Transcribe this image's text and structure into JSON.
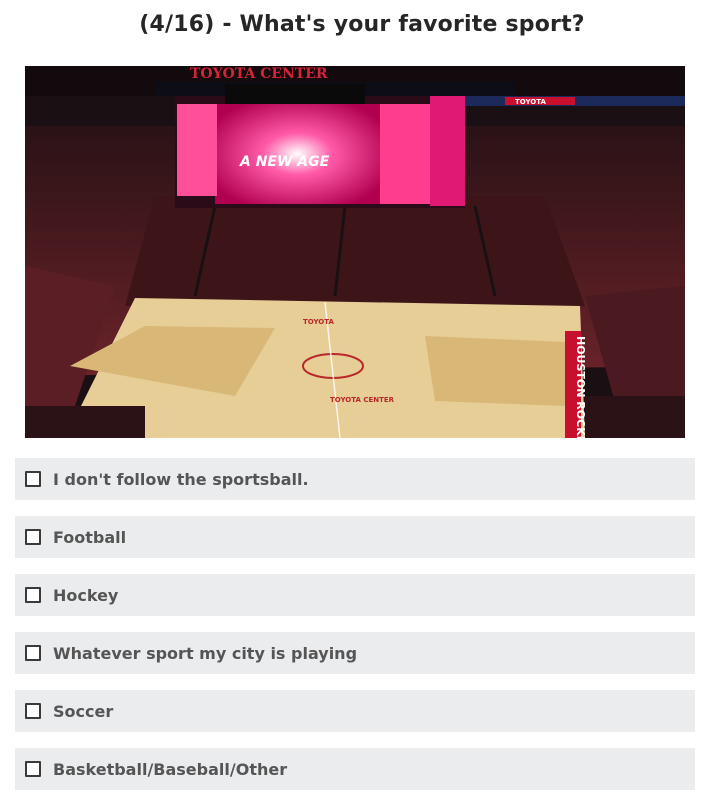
{
  "question": {
    "title": "(4/16) - What's your favorite sport?"
  },
  "photo": {
    "arena_sign": "TOYOTA CENTER",
    "scoreboard_text": "A NEW AGE",
    "court_text_top": "TOYOTA",
    "court_text_bottom": "TOYOTA CENTER",
    "baseline_text": "HOUSTON ROCKETS",
    "banner_right": "TOYOTA",
    "colors": {
      "court": "#e7cd96",
      "paint": "#d9b877",
      "seats": "#5a1e24",
      "screen": "#ff2f8a",
      "dark": "#1a0f12"
    }
  },
  "options": [
    {
      "label": "I don't follow the sportsball.",
      "checked": false
    },
    {
      "label": "Football",
      "checked": false
    },
    {
      "label": "Hockey",
      "checked": false
    },
    {
      "label": "Whatever sport my city is playing",
      "checked": false
    },
    {
      "label": "Soccer",
      "checked": false
    },
    {
      "label": "Basketball/Baseball/Other",
      "checked": false
    }
  ]
}
